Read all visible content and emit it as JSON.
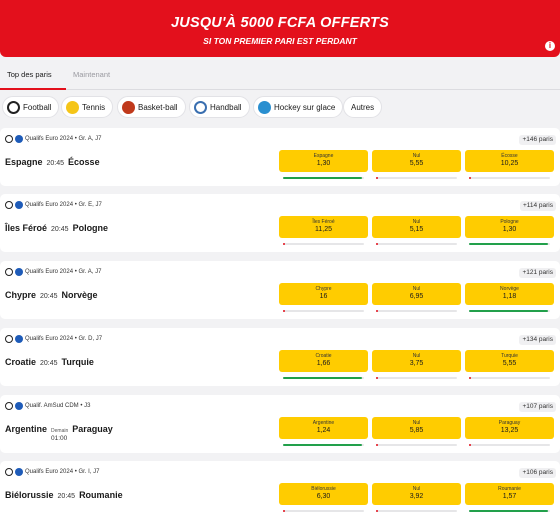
{
  "banner": {
    "title": "JUSQU'À 5000 FCFA OFFERTS",
    "subtitle": "SI TON PREMIER PARI EST PERDANT",
    "info": "i"
  },
  "tabs": {
    "active": "Top des paris",
    "inactive": "Maintenant"
  },
  "sports": [
    {
      "label": "Football",
      "icon": "soccer-ball-icon",
      "color": "#222222"
    },
    {
      "label": "Tennis",
      "icon": "tennis-ball-icon",
      "color": "#f5c518"
    },
    {
      "label": "Basket-ball",
      "icon": "basketball-icon",
      "color": "#c0391b"
    },
    {
      "label": "Handball",
      "icon": "handball-icon",
      "color": "#3a6fb0"
    },
    {
      "label": "Hockey sur glace",
      "icon": "hockey-puck-icon",
      "color": "#2a8fd0"
    },
    {
      "label": "Autres",
      "icon": "",
      "color": ""
    }
  ],
  "matches": [
    {
      "competition": "Qualifs Euro 2024 • Gr. A, J7",
      "more": "+146 paris",
      "home": "Espagne",
      "time": "20:45",
      "away": "Écosse",
      "odds": [
        {
          "label": "Espagne",
          "value": "1,30",
          "share": 0.98,
          "color": "#22a04b"
        },
        {
          "label": "Nul",
          "value": "5,55",
          "share": 0.02,
          "color": "#e3101c"
        },
        {
          "label": "Écosse",
          "value": "10,25",
          "share": 0.02,
          "color": "#e3101c"
        }
      ]
    },
    {
      "competition": "Qualifs Euro 2024 • Gr. E, J7",
      "more": "+114 paris",
      "home": "Îles Féroé",
      "time": "20:45",
      "away": "Pologne",
      "odds": [
        {
          "label": "Îles Féroé",
          "value": "11,25",
          "share": 0.02,
          "color": "#e3101c"
        },
        {
          "label": "Nul",
          "value": "5,15",
          "share": 0.02,
          "color": "#e3101c"
        },
        {
          "label": "Pologne",
          "value": "1,30",
          "share": 0.98,
          "color": "#22a04b"
        }
      ]
    },
    {
      "competition": "Qualifs Euro 2024 • Gr. A, J7",
      "more": "+121 paris",
      "home": "Chypre",
      "time": "20:45",
      "away": "Norvège",
      "odds": [
        {
          "label": "Chypre",
          "value": "16",
          "share": 0.02,
          "color": "#e3101c"
        },
        {
          "label": "Nul",
          "value": "6,95",
          "share": 0.02,
          "color": "#e3101c"
        },
        {
          "label": "Norvège",
          "value": "1,18",
          "share": 0.98,
          "color": "#22a04b"
        }
      ]
    },
    {
      "competition": "Qualifs Euro 2024 • Gr. D, J7",
      "more": "+134 paris",
      "home": "Croatie",
      "time": "20:45",
      "away": "Turquie",
      "odds": [
        {
          "label": "Croatie",
          "value": "1,66",
          "share": 0.98,
          "color": "#22a04b"
        },
        {
          "label": "Nul",
          "value": "3,75",
          "share": 0.02,
          "color": "#e3101c"
        },
        {
          "label": "Turquie",
          "value": "5,55",
          "share": 0.02,
          "color": "#e3101c"
        }
      ]
    },
    {
      "competition": "Qualif. AmSud CDM • J3",
      "more": "+107 paris",
      "home": "Argentine",
      "time_top": "Demain",
      "time": "01:00",
      "away": "Paraguay",
      "odds": [
        {
          "label": "Argentine",
          "value": "1,24",
          "share": 0.98,
          "color": "#22a04b"
        },
        {
          "label": "Nul",
          "value": "5,85",
          "share": 0.02,
          "color": "#e3101c"
        },
        {
          "label": "Paraguay",
          "value": "13,25",
          "share": 0.02,
          "color": "#e3101c"
        }
      ]
    },
    {
      "competition": "Qualifs Euro 2024 • Gr. I, J7",
      "more": "+106 paris",
      "home": "Biélorussie",
      "time": "20:45",
      "away": "Roumanie",
      "odds": [
        {
          "label": "Biélorussie",
          "value": "6,30",
          "share": 0.02,
          "color": "#e3101c"
        },
        {
          "label": "Nul",
          "value": "3,92",
          "share": 0.02,
          "color": "#e3101c"
        },
        {
          "label": "Roumanie",
          "value": "1,57",
          "share": 0.98,
          "color": "#22a04b"
        }
      ]
    }
  ]
}
